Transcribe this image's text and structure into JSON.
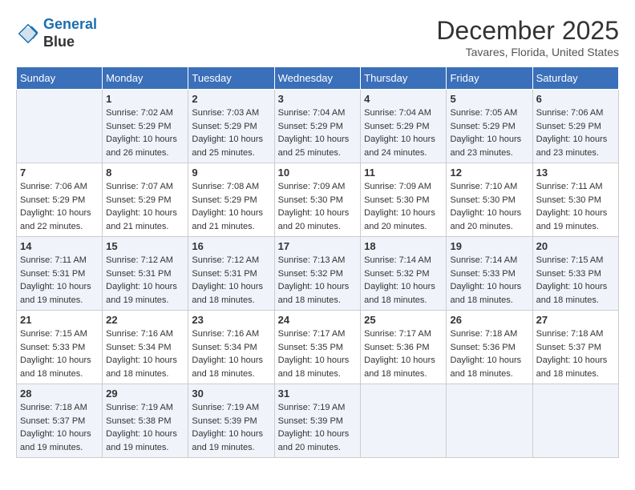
{
  "logo": {
    "line1": "General",
    "line2": "Blue"
  },
  "title": "December 2025",
  "location": "Tavares, Florida, United States",
  "days_of_week": [
    "Sunday",
    "Monday",
    "Tuesday",
    "Wednesday",
    "Thursday",
    "Friday",
    "Saturday"
  ],
  "weeks": [
    [
      {
        "num": "",
        "sunrise": "",
        "sunset": "",
        "daylight": ""
      },
      {
        "num": "1",
        "sunrise": "Sunrise: 7:02 AM",
        "sunset": "Sunset: 5:29 PM",
        "daylight": "Daylight: 10 hours and 26 minutes."
      },
      {
        "num": "2",
        "sunrise": "Sunrise: 7:03 AM",
        "sunset": "Sunset: 5:29 PM",
        "daylight": "Daylight: 10 hours and 25 minutes."
      },
      {
        "num": "3",
        "sunrise": "Sunrise: 7:04 AM",
        "sunset": "Sunset: 5:29 PM",
        "daylight": "Daylight: 10 hours and 25 minutes."
      },
      {
        "num": "4",
        "sunrise": "Sunrise: 7:04 AM",
        "sunset": "Sunset: 5:29 PM",
        "daylight": "Daylight: 10 hours and 24 minutes."
      },
      {
        "num": "5",
        "sunrise": "Sunrise: 7:05 AM",
        "sunset": "Sunset: 5:29 PM",
        "daylight": "Daylight: 10 hours and 23 minutes."
      },
      {
        "num": "6",
        "sunrise": "Sunrise: 7:06 AM",
        "sunset": "Sunset: 5:29 PM",
        "daylight": "Daylight: 10 hours and 23 minutes."
      }
    ],
    [
      {
        "num": "7",
        "sunrise": "Sunrise: 7:06 AM",
        "sunset": "Sunset: 5:29 PM",
        "daylight": "Daylight: 10 hours and 22 minutes."
      },
      {
        "num": "8",
        "sunrise": "Sunrise: 7:07 AM",
        "sunset": "Sunset: 5:29 PM",
        "daylight": "Daylight: 10 hours and 21 minutes."
      },
      {
        "num": "9",
        "sunrise": "Sunrise: 7:08 AM",
        "sunset": "Sunset: 5:29 PM",
        "daylight": "Daylight: 10 hours and 21 minutes."
      },
      {
        "num": "10",
        "sunrise": "Sunrise: 7:09 AM",
        "sunset": "Sunset: 5:30 PM",
        "daylight": "Daylight: 10 hours and 20 minutes."
      },
      {
        "num": "11",
        "sunrise": "Sunrise: 7:09 AM",
        "sunset": "Sunset: 5:30 PM",
        "daylight": "Daylight: 10 hours and 20 minutes."
      },
      {
        "num": "12",
        "sunrise": "Sunrise: 7:10 AM",
        "sunset": "Sunset: 5:30 PM",
        "daylight": "Daylight: 10 hours and 20 minutes."
      },
      {
        "num": "13",
        "sunrise": "Sunrise: 7:11 AM",
        "sunset": "Sunset: 5:30 PM",
        "daylight": "Daylight: 10 hours and 19 minutes."
      }
    ],
    [
      {
        "num": "14",
        "sunrise": "Sunrise: 7:11 AM",
        "sunset": "Sunset: 5:31 PM",
        "daylight": "Daylight: 10 hours and 19 minutes."
      },
      {
        "num": "15",
        "sunrise": "Sunrise: 7:12 AM",
        "sunset": "Sunset: 5:31 PM",
        "daylight": "Daylight: 10 hours and 19 minutes."
      },
      {
        "num": "16",
        "sunrise": "Sunrise: 7:12 AM",
        "sunset": "Sunset: 5:31 PM",
        "daylight": "Daylight: 10 hours and 18 minutes."
      },
      {
        "num": "17",
        "sunrise": "Sunrise: 7:13 AM",
        "sunset": "Sunset: 5:32 PM",
        "daylight": "Daylight: 10 hours and 18 minutes."
      },
      {
        "num": "18",
        "sunrise": "Sunrise: 7:14 AM",
        "sunset": "Sunset: 5:32 PM",
        "daylight": "Daylight: 10 hours and 18 minutes."
      },
      {
        "num": "19",
        "sunrise": "Sunrise: 7:14 AM",
        "sunset": "Sunset: 5:33 PM",
        "daylight": "Daylight: 10 hours and 18 minutes."
      },
      {
        "num": "20",
        "sunrise": "Sunrise: 7:15 AM",
        "sunset": "Sunset: 5:33 PM",
        "daylight": "Daylight: 10 hours and 18 minutes."
      }
    ],
    [
      {
        "num": "21",
        "sunrise": "Sunrise: 7:15 AM",
        "sunset": "Sunset: 5:33 PM",
        "daylight": "Daylight: 10 hours and 18 minutes."
      },
      {
        "num": "22",
        "sunrise": "Sunrise: 7:16 AM",
        "sunset": "Sunset: 5:34 PM",
        "daylight": "Daylight: 10 hours and 18 minutes."
      },
      {
        "num": "23",
        "sunrise": "Sunrise: 7:16 AM",
        "sunset": "Sunset: 5:34 PM",
        "daylight": "Daylight: 10 hours and 18 minutes."
      },
      {
        "num": "24",
        "sunrise": "Sunrise: 7:17 AM",
        "sunset": "Sunset: 5:35 PM",
        "daylight": "Daylight: 10 hours and 18 minutes."
      },
      {
        "num": "25",
        "sunrise": "Sunrise: 7:17 AM",
        "sunset": "Sunset: 5:36 PM",
        "daylight": "Daylight: 10 hours and 18 minutes."
      },
      {
        "num": "26",
        "sunrise": "Sunrise: 7:18 AM",
        "sunset": "Sunset: 5:36 PM",
        "daylight": "Daylight: 10 hours and 18 minutes."
      },
      {
        "num": "27",
        "sunrise": "Sunrise: 7:18 AM",
        "sunset": "Sunset: 5:37 PM",
        "daylight": "Daylight: 10 hours and 18 minutes."
      }
    ],
    [
      {
        "num": "28",
        "sunrise": "Sunrise: 7:18 AM",
        "sunset": "Sunset: 5:37 PM",
        "daylight": "Daylight: 10 hours and 19 minutes."
      },
      {
        "num": "29",
        "sunrise": "Sunrise: 7:19 AM",
        "sunset": "Sunset: 5:38 PM",
        "daylight": "Daylight: 10 hours and 19 minutes."
      },
      {
        "num": "30",
        "sunrise": "Sunrise: 7:19 AM",
        "sunset": "Sunset: 5:39 PM",
        "daylight": "Daylight: 10 hours and 19 minutes."
      },
      {
        "num": "31",
        "sunrise": "Sunrise: 7:19 AM",
        "sunset": "Sunset: 5:39 PM",
        "daylight": "Daylight: 10 hours and 20 minutes."
      },
      {
        "num": "",
        "sunrise": "",
        "sunset": "",
        "daylight": ""
      },
      {
        "num": "",
        "sunrise": "",
        "sunset": "",
        "daylight": ""
      },
      {
        "num": "",
        "sunrise": "",
        "sunset": "",
        "daylight": ""
      }
    ]
  ]
}
